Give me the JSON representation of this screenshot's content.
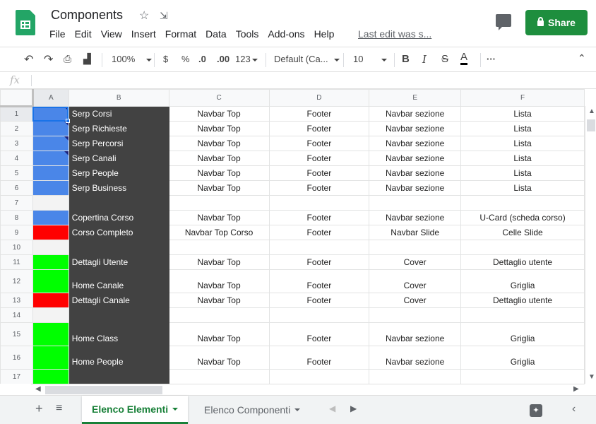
{
  "doc": {
    "title": "Components",
    "last_edit": "Last edit was s..."
  },
  "menu": [
    "File",
    "Edit",
    "View",
    "Insert",
    "Format",
    "Data",
    "Tools",
    "Add-ons",
    "Help"
  ],
  "share_label": "Share",
  "toolbar": {
    "zoom": "100%",
    "currency": "$",
    "percent": "%",
    "dec_decrease": ".0",
    "dec_increase": ".00",
    "more_formats": "123",
    "font": "Default (Ca...",
    "font_size": "10",
    "bold": "B",
    "italic": "I",
    "strike": "S",
    "text_color": "A",
    "more": "···"
  },
  "formula_bar": {
    "fx": "fx"
  },
  "columns": [
    "A",
    "B",
    "C",
    "D",
    "E",
    "F"
  ],
  "colors": {
    "blue": "#4a86e8",
    "red": "#ff0000",
    "green": "#00ff00",
    "light": "#f3f3f3",
    "dark": "#424242",
    "brand": "#1e8e3e"
  },
  "rows": [
    {
      "n": "1",
      "a": "blue",
      "note": true,
      "b": "Serp Corsi",
      "c": "Navbar Top",
      "d": "Footer",
      "e": "Navbar sezione",
      "f": "Lista"
    },
    {
      "n": "2",
      "a": "blue",
      "note": true,
      "b": "Serp Richieste",
      "c": "Navbar Top",
      "d": "Footer",
      "e": "Navbar sezione",
      "f": "Lista"
    },
    {
      "n": "3",
      "a": "blue",
      "note": true,
      "b": "Serp Percorsi",
      "c": "Navbar Top",
      "d": "Footer",
      "e": "Navbar sezione",
      "f": "Lista"
    },
    {
      "n": "4",
      "a": "blue",
      "note": true,
      "b": "Serp Canali",
      "c": "Navbar Top",
      "d": "Footer",
      "e": "Navbar sezione",
      "f": "Lista"
    },
    {
      "n": "5",
      "a": "blue",
      "note": false,
      "b": "Serp People",
      "c": "Navbar Top",
      "d": "Footer",
      "e": "Navbar sezione",
      "f": "Lista"
    },
    {
      "n": "6",
      "a": "blue",
      "note": false,
      "b": "Serp Business",
      "c": "Navbar Top",
      "d": "Footer",
      "e": "Navbar sezione",
      "f": "Lista"
    },
    {
      "n": "7",
      "a": "light",
      "note": false,
      "b": "",
      "c": "",
      "d": "",
      "e": "",
      "f": ""
    },
    {
      "n": "8",
      "a": "blue",
      "note": false,
      "b": "Copertina Corso",
      "c": "Navbar Top",
      "d": "Footer",
      "e": "Navbar sezione",
      "f": "U-Card (scheda corso)"
    },
    {
      "n": "9",
      "a": "red",
      "note": false,
      "b": "Corso Completo",
      "c": "Navbar Top Corso",
      "d": "Footer",
      "e": "Navbar Slide",
      "f": "Celle Slide"
    },
    {
      "n": "10",
      "a": "light",
      "note": false,
      "b": "",
      "c": "",
      "d": "",
      "e": "",
      "f": ""
    },
    {
      "n": "11",
      "a": "green",
      "note": false,
      "b": "Dettagli Utente",
      "c": "Navbar Top",
      "d": "Footer",
      "e": "Cover",
      "f": "Dettaglio utente"
    },
    {
      "n": "12",
      "a": "green",
      "note": false,
      "b": "Home Canale",
      "c": "Navbar Top",
      "d": "Footer",
      "e": "Cover",
      "f": "Griglia"
    },
    {
      "n": "13",
      "a": "red",
      "note": false,
      "b": "Dettagli Canale",
      "c": "Navbar Top",
      "d": "Footer",
      "e": "Cover",
      "f": "Dettaglio utente"
    },
    {
      "n": "14",
      "a": "light",
      "note": false,
      "b": "",
      "c": "",
      "d": "",
      "e": "",
      "f": ""
    },
    {
      "n": "15",
      "a": "green",
      "note": false,
      "b": "Home Class",
      "c": "Navbar Top",
      "d": "Footer",
      "e": "Navbar sezione",
      "f": "Griglia"
    },
    {
      "n": "16",
      "a": "green",
      "note": false,
      "b": "Home People",
      "c": "Navbar Top",
      "d": "Footer",
      "e": "Navbar sezione",
      "f": "Griglia"
    },
    {
      "n": "17",
      "a": "green",
      "note": false,
      "b": "",
      "c": "",
      "d": "",
      "e": "",
      "f": ""
    }
  ],
  "tabs": [
    {
      "label": "Elenco Elementi",
      "active": true
    },
    {
      "label": "Elenco Componenti",
      "active": false
    }
  ]
}
